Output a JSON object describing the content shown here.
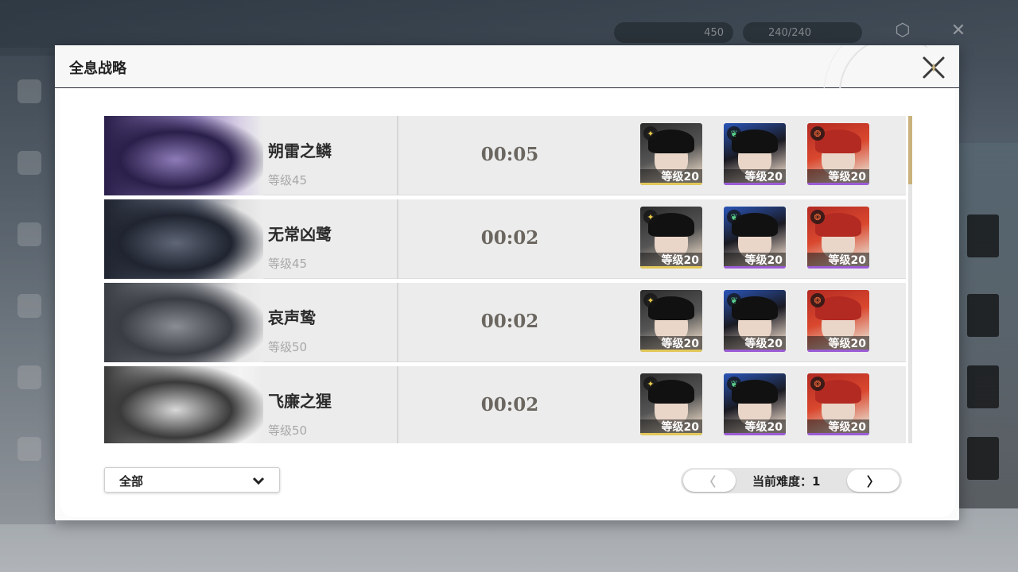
{
  "colors": {
    "accent_gold": "#c9b27c",
    "time_text": "#6b6760",
    "level_text": "#a8a8a8",
    "bar_gold": "#e2c85a",
    "bar_purple": "#9b5cd6"
  },
  "modal": {
    "title": "全息战略",
    "close_icon": "close-x-icon"
  },
  "bosses": [
    {
      "name": "朔雷之鳞",
      "level": "等级45",
      "time": "00:05",
      "team": [
        {
          "element": "spectro-icon",
          "level": "等级20",
          "bar": "gold"
        },
        {
          "element": "aero-icon",
          "level": "等级20",
          "bar": "purple"
        },
        {
          "element": "fusion-icon",
          "level": "等级20",
          "bar": "purple"
        }
      ]
    },
    {
      "name": "无常凶鹭",
      "level": "等级45",
      "time": "00:02",
      "team": [
        {
          "element": "spectro-icon",
          "level": "等级20",
          "bar": "gold"
        },
        {
          "element": "aero-icon",
          "level": "等级20",
          "bar": "purple"
        },
        {
          "element": "fusion-icon",
          "level": "等级20",
          "bar": "purple"
        }
      ]
    },
    {
      "name": "哀声鸷",
      "level": "等级50",
      "time": "00:02",
      "team": [
        {
          "element": "spectro-icon",
          "level": "等级20",
          "bar": "gold"
        },
        {
          "element": "aero-icon",
          "level": "等级20",
          "bar": "purple"
        },
        {
          "element": "fusion-icon",
          "level": "等级20",
          "bar": "purple"
        }
      ]
    },
    {
      "name": "飞廉之猩",
      "level": "等级50",
      "time": "00:02",
      "team": [
        {
          "element": "spectro-icon",
          "level": "等级20",
          "bar": "gold"
        },
        {
          "element": "aero-icon",
          "level": "等级20",
          "bar": "purple"
        },
        {
          "element": "fusion-icon",
          "level": "等级20",
          "bar": "purple"
        }
      ]
    }
  ],
  "filter": {
    "selected": "全部"
  },
  "pager": {
    "prev": "〈",
    "label": "当前难度：1",
    "next": "〉"
  },
  "hud": {
    "currency_value": "450",
    "stamina_value": "240/240"
  }
}
